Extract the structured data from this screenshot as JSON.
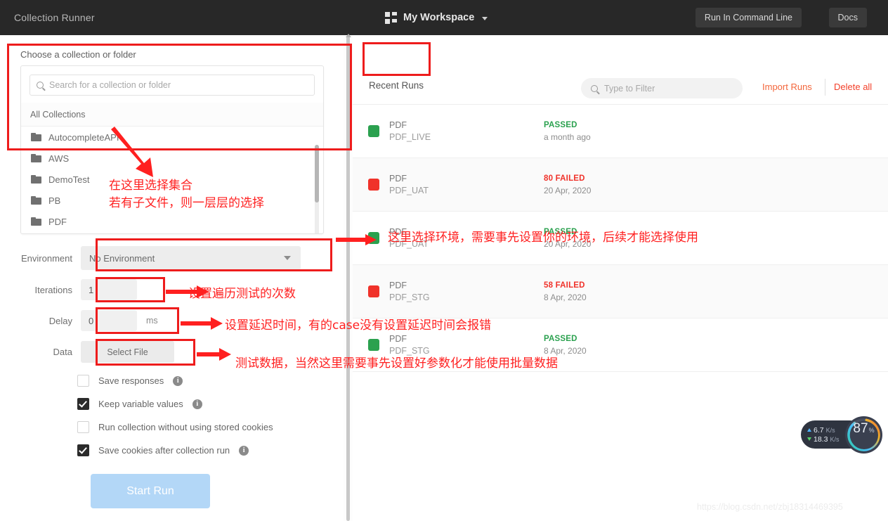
{
  "topbar": {
    "app_title": "Collection Runner",
    "workspace_name": "My Workspace",
    "workspace_icon": "grid-icon",
    "caret_icon": "chevron-down-icon",
    "run_cli_label": "Run In Command Line",
    "docs_label": "Docs"
  },
  "chooser": {
    "label": "Choose a collection or folder",
    "search_placeholder": "Search for a collection or folder",
    "search_value": "",
    "search_icon": "search-icon",
    "group_header": "All Collections",
    "collections": [
      {
        "name": "AutocompleteAPI",
        "icon": "folder-icon"
      },
      {
        "name": "AWS",
        "icon": "folder-icon"
      },
      {
        "name": "DemoTest",
        "icon": "folder-icon"
      },
      {
        "name": "PB",
        "icon": "folder-icon"
      },
      {
        "name": "PDF",
        "icon": "folder-icon"
      }
    ]
  },
  "form": {
    "environment_label": "Environment",
    "environment_value": "No Environment",
    "environment_caret": "chevron-down-icon",
    "iterations_label": "Iterations",
    "iterations_value": "1",
    "delay_label": "Delay",
    "delay_value": "0",
    "delay_unit": "ms",
    "data_label": "Data",
    "select_file_label": "Select File",
    "checkboxes": [
      {
        "label": "Save responses",
        "checked": false,
        "info": true
      },
      {
        "label": "Keep variable values",
        "checked": true,
        "info": true
      },
      {
        "label": "Run collection without using stored cookies",
        "checked": false,
        "info": false
      },
      {
        "label": "Save cookies after collection run",
        "checked": true,
        "info": true
      }
    ],
    "start_run_label": "Start Run"
  },
  "runs_panel": {
    "title": "Recent Runs",
    "filter_placeholder": "Type to Filter",
    "filter_value": "",
    "filter_icon": "search-icon",
    "import_runs_label": "Import Runs",
    "delete_all_label": "Delete all",
    "colors": {
      "passed": "#2ba14f",
      "failed": "#f0322a",
      "accent_orange": "#f3663b"
    },
    "rows": [
      {
        "name": "PDF",
        "environment": "PDF_LIVE",
        "verdict": "PASSED",
        "status": "passed",
        "date": "a month ago"
      },
      {
        "name": "PDF",
        "environment": "PDF_UAT",
        "verdict": "80 FAILED",
        "status": "failed",
        "date": "20 Apr, 2020"
      },
      {
        "name": "PDF",
        "environment": "PDF_UAT",
        "verdict": "PASSED",
        "status": "passed",
        "date": "20 Apr, 2020"
      },
      {
        "name": "PDF",
        "environment": "PDF_STG",
        "verdict": "58 FAILED",
        "status": "failed",
        "date": "8 Apr, 2020"
      },
      {
        "name": "PDF",
        "environment": "PDF_STG",
        "verdict": "PASSED",
        "status": "passed",
        "date": "8 Apr, 2020"
      }
    ]
  },
  "annotations": {
    "color": "#ff2020",
    "collection_line1": "在这里选择集合",
    "collection_line2": "若有子文件，则一层层的选择",
    "environment_note": "这里选择环境，需要事先设置你的环境，后续才能选择使用",
    "iterations_note": "设置遍历测试的次数",
    "delay_note": "设置延迟时间，有的case没有设置延迟时间会报错",
    "data_note": "测试数据，当然这里需要事先设置好参数化才能使用批量数据"
  },
  "net_widget": {
    "upload": "6.7",
    "upload_unit": "K/s",
    "download": "18.3",
    "download_unit": "K/s",
    "cpu_value": "87",
    "cpu_unit": "%",
    "up_icon": "arrow-up-icon",
    "down_icon": "arrow-down-icon"
  },
  "watermark": "https://blog.csdn.net/zbj18314469395"
}
